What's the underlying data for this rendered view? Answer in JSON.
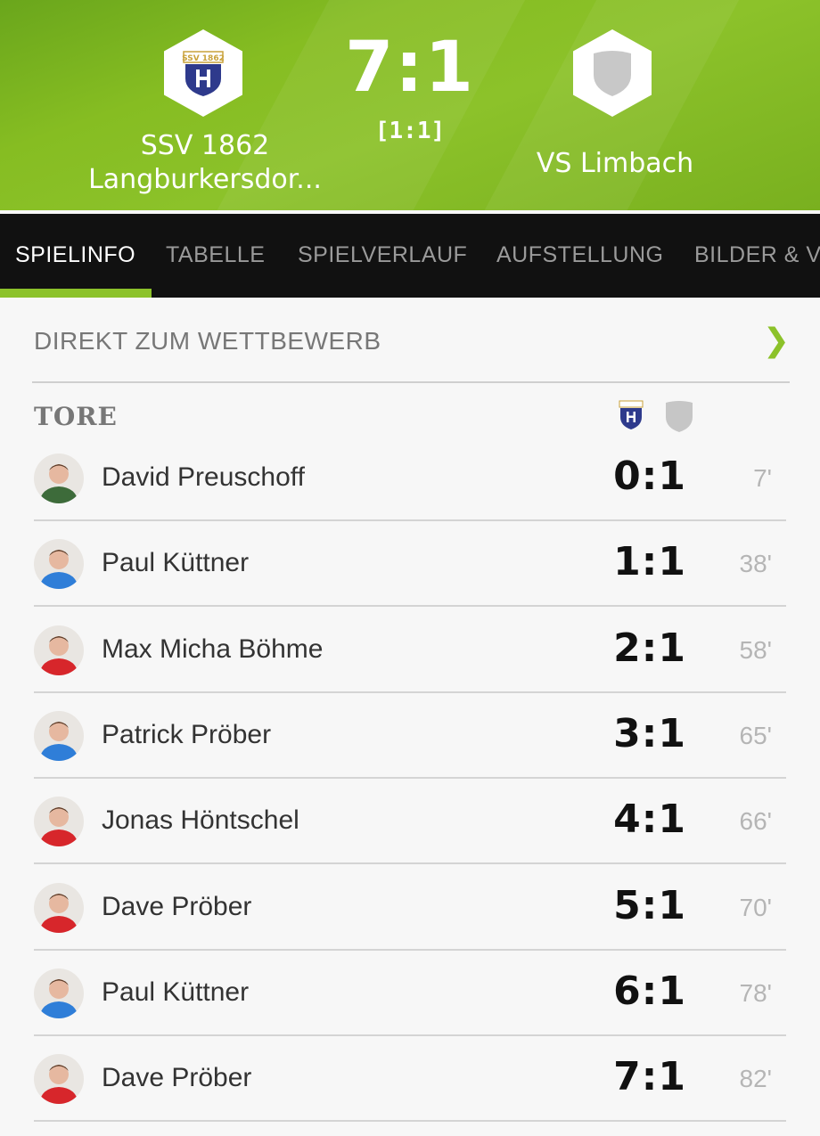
{
  "match": {
    "home_team": "SSV 1862",
    "home_team_line2": "Langburkersdor...",
    "away_team": "VS Limbach",
    "score": "7:1",
    "halftime": "[1:1]",
    "home_logo_text": "SSV 1862"
  },
  "tabs": [
    {
      "label": "SPIELINFO",
      "active": true
    },
    {
      "label": "TABELLE",
      "active": false
    },
    {
      "label": "SPIELVERLAUF",
      "active": false
    },
    {
      "label": "AUFSTELLUNG",
      "active": false
    },
    {
      "label": "BILDER & V",
      "active": false
    }
  ],
  "competition_link": {
    "label": "DIREKT ZUM WETTBEWERB",
    "icon": "chevron-right-icon"
  },
  "goals_section": {
    "title": "TORE",
    "goals": [
      {
        "player": "David Preuschoff",
        "score": "0:1",
        "minute": "7'",
        "team": "away",
        "shirt": "green"
      },
      {
        "player": "Paul Küttner",
        "score": "1:1",
        "minute": "38'",
        "team": "home",
        "shirt": "blue"
      },
      {
        "player": "Max Micha Böhme",
        "score": "2:1",
        "minute": "58'",
        "team": "home",
        "shirt": "red"
      },
      {
        "player": "Patrick Pröber",
        "score": "3:1",
        "minute": "65'",
        "team": "home",
        "shirt": "blue"
      },
      {
        "player": "Jonas Höntschel",
        "score": "4:1",
        "minute": "66'",
        "team": "home",
        "shirt": "red"
      },
      {
        "player": "Dave Pröber",
        "score": "5:1",
        "minute": "70'",
        "team": "home",
        "shirt": "red"
      },
      {
        "player": "Paul Küttner",
        "score": "6:1",
        "minute": "78'",
        "team": "home",
        "shirt": "blue"
      },
      {
        "player": "Dave Pröber",
        "score": "7:1",
        "minute": "82'",
        "team": "home",
        "shirt": "red"
      }
    ]
  },
  "colors": {
    "accent": "#8cc22a",
    "tab_bar": "#111111",
    "shirt_red": "#d7262b",
    "shirt_blue": "#2f7ed8",
    "shirt_green": "#3d6b3a"
  }
}
